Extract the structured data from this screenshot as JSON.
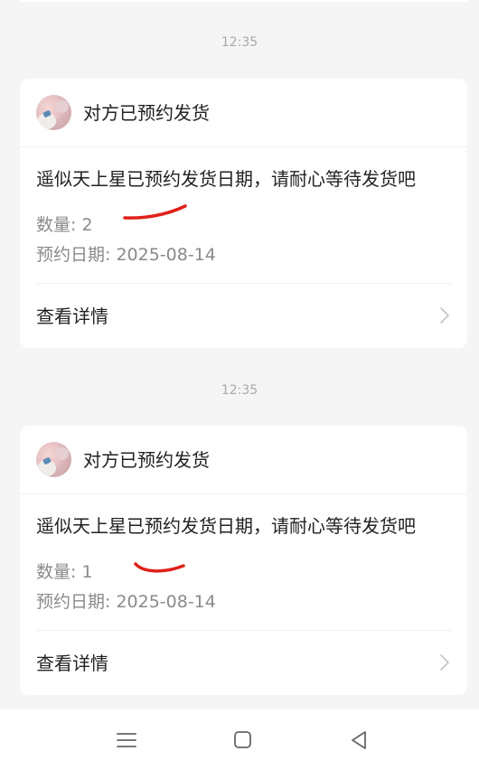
{
  "messages": [
    {
      "time": "12:35",
      "title": "对方已预约发货",
      "body": "遥似天上星已预约发货日期，请耐心等待发货吧",
      "quantity_label": "数量: 2",
      "date_label": "预约日期: 2025-08-14",
      "link_label": "查看详情"
    },
    {
      "time": "12:35",
      "title": "对方已预约发货",
      "body": "遥似天上星已预约发货日期，请耐心等待发货吧",
      "quantity_label": "数量: 1",
      "date_label": "预约日期: 2025-08-14",
      "link_label": "查看详情"
    }
  ],
  "annotation_color": "#e0201a",
  "nav": {
    "icons": [
      "menu-icon",
      "home-square-icon",
      "back-triangle-icon"
    ]
  }
}
